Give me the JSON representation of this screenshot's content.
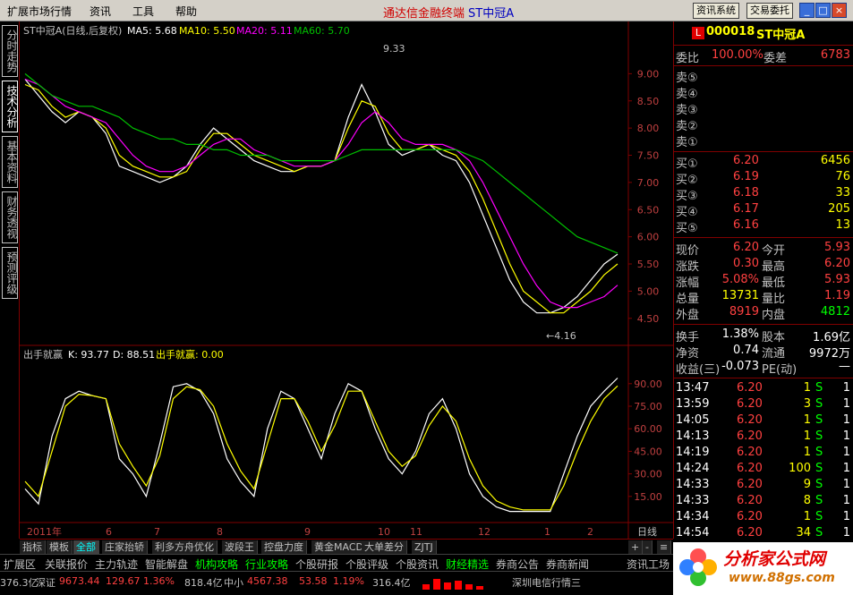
{
  "menu": {
    "items": [
      "扩展市场行情",
      "资讯",
      "工具",
      "帮助"
    ]
  },
  "app": {
    "title": "通达信金融终端",
    "stock_tag": "ST中冠A"
  },
  "toolbar": {
    "news_sys": "资讯系统",
    "trade": "交易委托"
  },
  "window": {
    "min": "_",
    "max": "□",
    "close": "×"
  },
  "left_tabs": [
    "分时走势",
    "技术分析",
    "基本资料",
    "财务透视",
    "预测评级"
  ],
  "chart_header": {
    "name": "ST中冠A(日线,后复权)",
    "ma5": "MA5: 5.68",
    "ma10": "MA10: 5.50",
    "ma20": "MA20: 5.11",
    "ma60": "MA60: 5.70"
  },
  "indicator_header": {
    "name": "出手就赢",
    "k": "K: 93.77",
    "d": "D: 88.51",
    "signal": "出手就赢: 0.00"
  },
  "annotations": {
    "high": "9.33",
    "low": "←4.16"
  },
  "colors": {
    "up": "#ff4040",
    "down": "#00e0e0",
    "ma5": "#ffffff",
    "ma10": "#ffff00",
    "ma20": "#ff00ff",
    "ma60": "#00c000",
    "border": "#800000"
  },
  "chart_data": {
    "type": "line",
    "price_axis": {
      "ticks": [
        "9.00",
        "8.50",
        "8.00",
        "7.50",
        "7.00",
        "6.50",
        "6.00",
        "5.50",
        "5.00",
        "4.50"
      ],
      "ylim": [
        4.2,
        9.5
      ]
    },
    "indicator_axis": {
      "ticks": [
        "90.00",
        "75.00",
        "60.00",
        "45.00",
        "30.00",
        "15.00"
      ],
      "ylim": [
        0,
        100
      ]
    },
    "x_labels": [
      "2011年",
      "6",
      "7",
      "8",
      "9",
      "10",
      "11",
      "12",
      "1",
      "2"
    ],
    "period_label": "日线",
    "series": [
      {
        "name": "MA5",
        "values": [
          8.9,
          8.6,
          8.3,
          8.1,
          8.3,
          8.2,
          7.9,
          7.3,
          7.2,
          7.1,
          7.0,
          7.1,
          7.3,
          7.7,
          8.0,
          7.8,
          7.6,
          7.4,
          7.3,
          7.2,
          7.2,
          7.3,
          7.3,
          7.4,
          8.2,
          8.8,
          8.3,
          7.7,
          7.5,
          7.6,
          7.7,
          7.5,
          7.4,
          7.0,
          6.4,
          5.8,
          5.2,
          4.8,
          4.6,
          4.6,
          4.7,
          4.9,
          5.2,
          5.5,
          5.68
        ]
      },
      {
        "name": "MA10",
        "values": [
          8.8,
          8.7,
          8.4,
          8.2,
          8.3,
          8.2,
          8.0,
          7.5,
          7.3,
          7.2,
          7.1,
          7.1,
          7.2,
          7.6,
          7.9,
          7.9,
          7.7,
          7.5,
          7.4,
          7.3,
          7.2,
          7.3,
          7.3,
          7.4,
          8.0,
          8.5,
          8.4,
          7.9,
          7.6,
          7.6,
          7.7,
          7.6,
          7.5,
          7.2,
          6.7,
          6.1,
          5.5,
          5.0,
          4.8,
          4.6,
          4.6,
          4.8,
          5.0,
          5.3,
          5.5
        ]
      },
      {
        "name": "MA20",
        "values": [
          8.9,
          8.8,
          8.6,
          8.4,
          8.3,
          8.2,
          8.1,
          7.8,
          7.5,
          7.3,
          7.2,
          7.2,
          7.3,
          7.5,
          7.7,
          7.8,
          7.8,
          7.6,
          7.5,
          7.4,
          7.3,
          7.3,
          7.3,
          7.4,
          7.7,
          8.1,
          8.3,
          8.1,
          7.8,
          7.7,
          7.7,
          7.7,
          7.6,
          7.4,
          7.0,
          6.5,
          6.0,
          5.5,
          5.1,
          4.8,
          4.7,
          4.7,
          4.8,
          4.9,
          5.11
        ]
      },
      {
        "name": "MA60",
        "values": [
          9.0,
          8.8,
          8.6,
          8.5,
          8.4,
          8.4,
          8.3,
          8.2,
          8.0,
          7.9,
          7.8,
          7.8,
          7.7,
          7.7,
          7.6,
          7.6,
          7.5,
          7.5,
          7.5,
          7.4,
          7.4,
          7.4,
          7.4,
          7.4,
          7.5,
          7.6,
          7.6,
          7.6,
          7.6,
          7.6,
          7.6,
          7.6,
          7.6,
          7.5,
          7.4,
          7.2,
          7.0,
          6.8,
          6.6,
          6.4,
          6.2,
          6.0,
          5.9,
          5.8,
          5.7
        ]
      },
      {
        "name": "K",
        "values": [
          20,
          10,
          55,
          80,
          85,
          82,
          80,
          40,
          30,
          15,
          50,
          88,
          90,
          85,
          70,
          40,
          25,
          15,
          60,
          85,
          80,
          60,
          40,
          70,
          90,
          85,
          60,
          40,
          30,
          45,
          70,
          80,
          60,
          30,
          15,
          8,
          5,
          5,
          5,
          5,
          30,
          55,
          75,
          85,
          93.77
        ]
      },
      {
        "name": "D",
        "values": [
          25,
          15,
          45,
          75,
          83,
          82,
          80,
          50,
          35,
          22,
          42,
          80,
          88,
          86,
          75,
          50,
          32,
          20,
          50,
          80,
          80,
          65,
          45,
          62,
          85,
          85,
          65,
          45,
          35,
          42,
          62,
          75,
          65,
          40,
          22,
          12,
          8,
          6,
          6,
          6,
          22,
          45,
          65,
          80,
          88.51
        ]
      }
    ]
  },
  "quote": {
    "code": "000018",
    "name": "ST中冠A",
    "logo": "L",
    "ratio_label": "委比",
    "ratio": "100.00%",
    "diff_label": "委差",
    "diff": "6783",
    "sell": [
      {
        "label": "卖⑤",
        "price": "",
        "vol": ""
      },
      {
        "label": "卖④",
        "price": "",
        "vol": ""
      },
      {
        "label": "卖③",
        "price": "",
        "vol": ""
      },
      {
        "label": "卖②",
        "price": "",
        "vol": ""
      },
      {
        "label": "卖①",
        "price": "",
        "vol": ""
      }
    ],
    "buy": [
      {
        "label": "买①",
        "price": "6.20",
        "vol": "6456"
      },
      {
        "label": "买②",
        "price": "6.19",
        "vol": "76"
      },
      {
        "label": "买③",
        "price": "6.18",
        "vol": "33"
      },
      {
        "label": "买④",
        "price": "6.17",
        "vol": "205"
      },
      {
        "label": "买⑤",
        "price": "6.16",
        "vol": "13"
      }
    ],
    "stats": [
      {
        "l1": "现价",
        "v1": "6.20",
        "l2": "今开",
        "v2": "5.93"
      },
      {
        "l1": "涨跌",
        "v1": "0.30",
        "l2": "最高",
        "v2": "6.20"
      },
      {
        "l1": "涨幅",
        "v1": "5.08%",
        "l2": "最低",
        "v2": "5.93"
      },
      {
        "l1": "总量",
        "v1": "13731",
        "l2": "量比",
        "v2": "1.19"
      },
      {
        "l1": "外盘",
        "v1": "8919",
        "l2": "内盘",
        "v2": "4812"
      }
    ],
    "stats2": [
      {
        "l1": "换手",
        "v1": "1.38%",
        "l2": "股本",
        "v2": "1.69亿"
      },
      {
        "l1": "净资",
        "v1": "0.74",
        "l2": "流通",
        "v2": "9972万"
      },
      {
        "l1": "收益(三)",
        "v1": "-0.073",
        "l2": "PE(动)",
        "v2": "—"
      }
    ],
    "ticks": [
      {
        "time": "13:47",
        "price": "6.20",
        "vol": "1",
        "bs": "S",
        "n": "1"
      },
      {
        "time": "13:59",
        "price": "6.20",
        "vol": "3",
        "bs": "S",
        "n": "1"
      },
      {
        "time": "14:05",
        "price": "6.20",
        "vol": "1",
        "bs": "S",
        "n": "1"
      },
      {
        "time": "14:13",
        "price": "6.20",
        "vol": "1",
        "bs": "S",
        "n": "1"
      },
      {
        "time": "14:19",
        "price": "6.20",
        "vol": "1",
        "bs": "S",
        "n": "1"
      },
      {
        "time": "14:24",
        "price": "6.20",
        "vol": "100",
        "bs": "S",
        "n": "1"
      },
      {
        "time": "14:33",
        "price": "6.20",
        "vol": "9",
        "bs": "S",
        "n": "1"
      },
      {
        "time": "14:33",
        "price": "6.20",
        "vol": "8",
        "bs": "S",
        "n": "1"
      },
      {
        "time": "14:34",
        "price": "6.20",
        "vol": "1",
        "bs": "S",
        "n": "1"
      },
      {
        "time": "14:54",
        "price": "6.20",
        "vol": "34",
        "bs": "S",
        "n": "1"
      }
    ]
  },
  "indicator_tabs": [
    "指标",
    "模板",
    "全部",
    "庄家抬轿",
    "利多方舟优化",
    "波段王",
    "控盘力度",
    "黄金MACD",
    "大单差分",
    "ZJTJ"
  ],
  "scroll_btns": [
    "+",
    "-",
    "≡"
  ],
  "modules": [
    "扩展区",
    "关联报价",
    "主力轨迹",
    "智能解盘",
    "机构攻略",
    "行业攻略",
    "个股研报",
    "个股评级",
    "个股资讯",
    "财经精选",
    "券商公告",
    "券商新闻",
    "资讯工场"
  ],
  "status": {
    "s1": "376.3亿",
    "s2_label": "深证",
    "s2_val": "9673.44",
    "s2_chg": "129.67",
    "s2_pct": "1.36%",
    "s3": "818.4亿",
    "s4_label": "中小",
    "s4_val": "4567.38",
    "s4_chg": "53.58",
    "s4_pct": "1.19%",
    "s5": "316.4亿",
    "s6": "深圳电信行情三"
  },
  "logo": {
    "text": "分析家公式网",
    "url": "www.88gs.com"
  }
}
